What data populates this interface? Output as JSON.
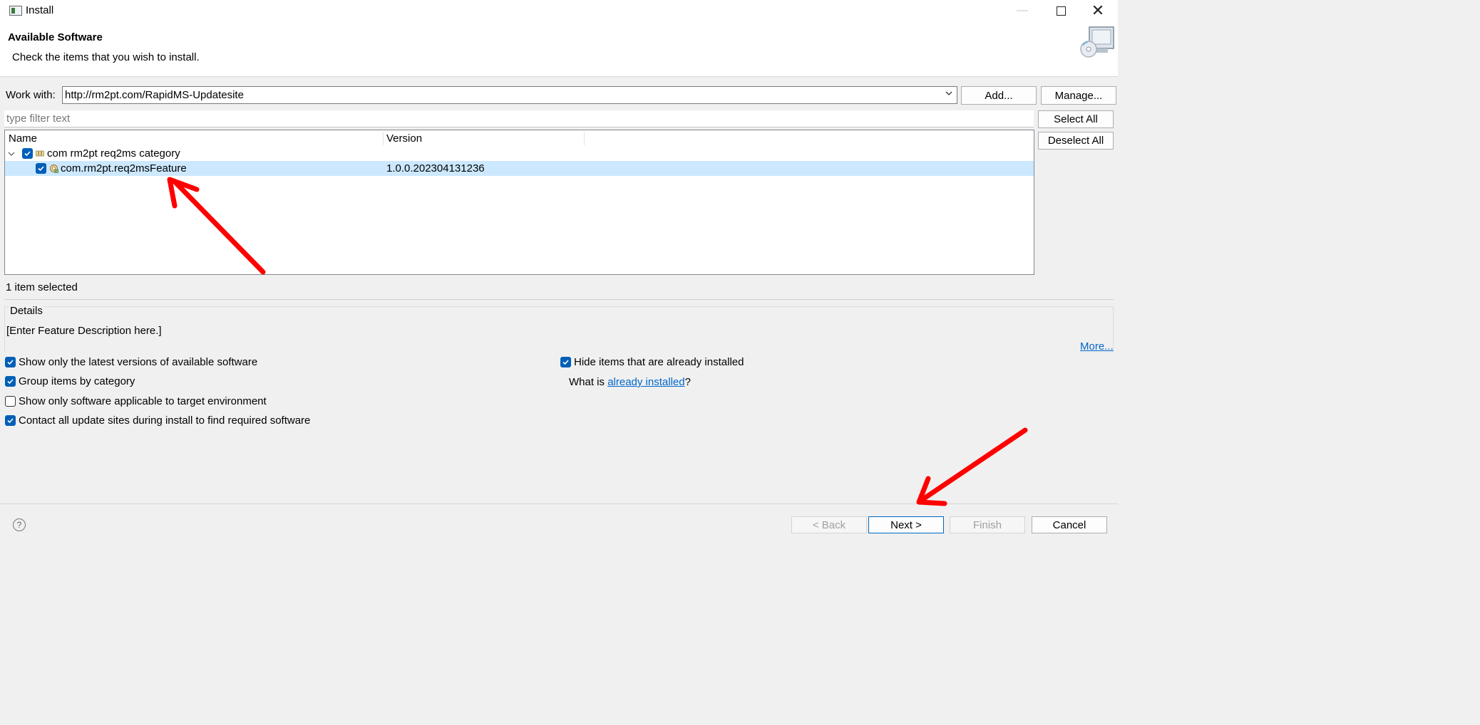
{
  "window": {
    "title": "Install"
  },
  "header": {
    "title": "Available Software",
    "subtitle": "Check the items that you wish to install."
  },
  "work_with": {
    "label": "Work with:",
    "value": "http://rm2pt.com/RapidMS-Updatesite",
    "add_label": "Add...",
    "manage_label": "Manage..."
  },
  "filter": {
    "placeholder": "type filter text"
  },
  "selection_buttons": {
    "select_all": "Select All",
    "deselect_all": "Deselect All"
  },
  "tree": {
    "columns": [
      "Name",
      "Version"
    ],
    "rows": [
      {
        "name": "com rm2pt req2ms category",
        "version": "",
        "checked": true,
        "expanded": true
      },
      {
        "name": "com.rm2pt.req2msFeature",
        "version": "1.0.0.202304131236",
        "checked": true,
        "selected": true
      }
    ]
  },
  "status": "1 item selected",
  "details": {
    "title": "Details",
    "text": "[Enter Feature Description here.]",
    "more": "More..."
  },
  "options": {
    "latest_versions": {
      "label": "Show only the latest versions of available software",
      "checked": true
    },
    "group_by_category": {
      "label": "Group items by category",
      "checked": true
    },
    "target_env": {
      "label": "Show only software applicable to target environment",
      "checked": false
    },
    "contact_sites": {
      "label": "Contact all update sites during install to find required software",
      "checked": true
    },
    "hide_installed": {
      "label": "Hide items that are already installed",
      "checked": true
    },
    "what_is": {
      "prefix": "What is ",
      "link": "already installed",
      "suffix": "?"
    }
  },
  "footer": {
    "back": "< Back",
    "next": "Next >",
    "finish": "Finish",
    "cancel": "Cancel"
  },
  "colors": {
    "annotation_arrow": "#ff0000",
    "checkbox": "#005fb8",
    "selection": "#cce8ff",
    "link": "#0066cc"
  }
}
